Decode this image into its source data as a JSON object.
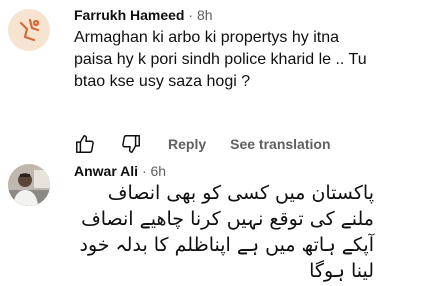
{
  "comments": [
    {
      "author": "Farrukh Hameed",
      "separator": "·",
      "time": "8h",
      "text": "Armaghan ki arbo ki propertys hy itna paisa hy k pori sindh police kharid le .. Tu btao kse usy saza hogi ?",
      "actions": {
        "like_icon": "thumbs-up-icon",
        "dislike_icon": "thumbs-down-icon",
        "reply_label": "Reply",
        "translate_label": "See translation"
      }
    },
    {
      "author": "Anwar Ali",
      "separator": "·",
      "time": "6h",
      "text": "پاکستان میں کسی کو بھی انصاف ملنے کی توقع نہیں کرنا چاھیے انصاف آپکے ہاتھ میں ہے اپناظلم کا بدلہ خود لینا ہوگا"
    }
  ]
}
